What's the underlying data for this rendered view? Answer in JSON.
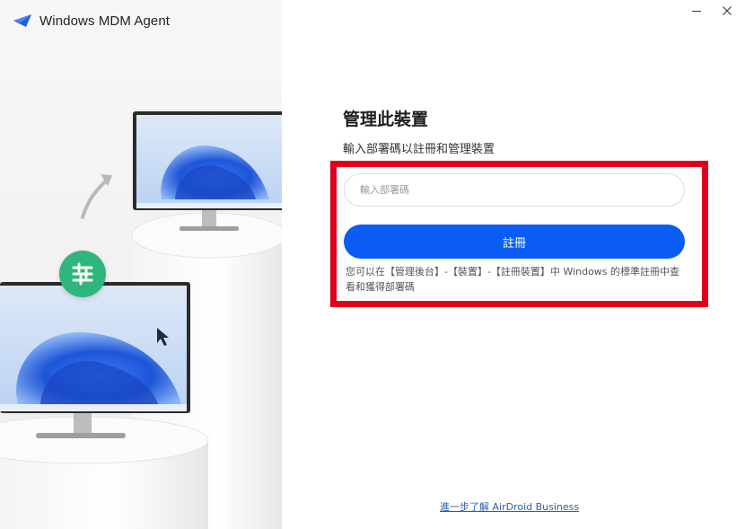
{
  "app": {
    "title": "Windows MDM Agent"
  },
  "window_controls": {
    "minimize_icon": "minimize-icon",
    "close_icon": "close-icon"
  },
  "main": {
    "title": "管理此裝置",
    "subtitle": "輸入部署碼以註冊和管理裝置",
    "code_input": {
      "placeholder": "輸入部署碼",
      "value": ""
    },
    "register_label": "註冊",
    "hint": "您可以在【管理後台】-【裝置】-【註冊裝置】中 Windows 的標準註冊中查看和獲得部署碼"
  },
  "footer": {
    "learn_more": "進一步了解 AirDroid Business"
  },
  "colors": {
    "accent": "#0a5cf5",
    "highlight": "#e0001b",
    "settings_badge": "#2fb67c"
  }
}
